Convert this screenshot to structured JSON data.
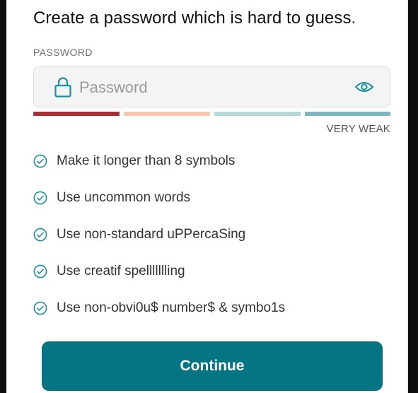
{
  "title": "Create a password which is hard to guess.",
  "password_field": {
    "label": "PASSWORD",
    "placeholder": "Password",
    "value": "",
    "lock_icon": "lock-icon",
    "visibility_icon": "eye-icon"
  },
  "strength": {
    "label": "VERY WEAK",
    "segment_colors": [
      "#a82f35",
      "#f8c7b2",
      "#b6d8db",
      "#7fb6bd"
    ]
  },
  "tips": [
    {
      "icon": "check-circle-icon",
      "text": "Make it longer than 8 symbols"
    },
    {
      "icon": "check-circle-icon",
      "text": "Use uncommon words"
    },
    {
      "icon": "check-circle-icon",
      "text": "Use non-standard uPPercaSing"
    },
    {
      "icon": "check-circle-icon",
      "text": "Use creatif spellllllling"
    },
    {
      "icon": "check-circle-icon",
      "text": "Use non-obvi0u$ number$ & symbo1s"
    }
  ],
  "continue_label": "Continue",
  "colors": {
    "accent": "#057583",
    "check": "#1a8f9e",
    "text": "#111111"
  }
}
